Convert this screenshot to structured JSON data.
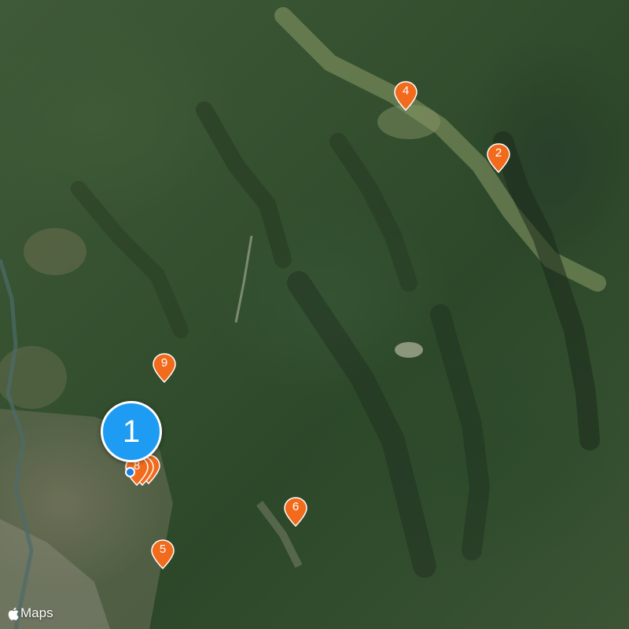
{
  "map": {
    "type": "satellite",
    "attribution": {
      "brand": "Maps"
    }
  },
  "cluster": {
    "count": "1"
  },
  "pins": [
    {
      "label": "4"
    },
    {
      "label": "2"
    },
    {
      "label": "9"
    },
    {
      "label": "8"
    },
    {
      "label": "6"
    },
    {
      "label": "5"
    }
  ],
  "colors": {
    "pin": "#f26b1d",
    "cluster": "#1e9bf2",
    "terrain": "#34502f"
  }
}
